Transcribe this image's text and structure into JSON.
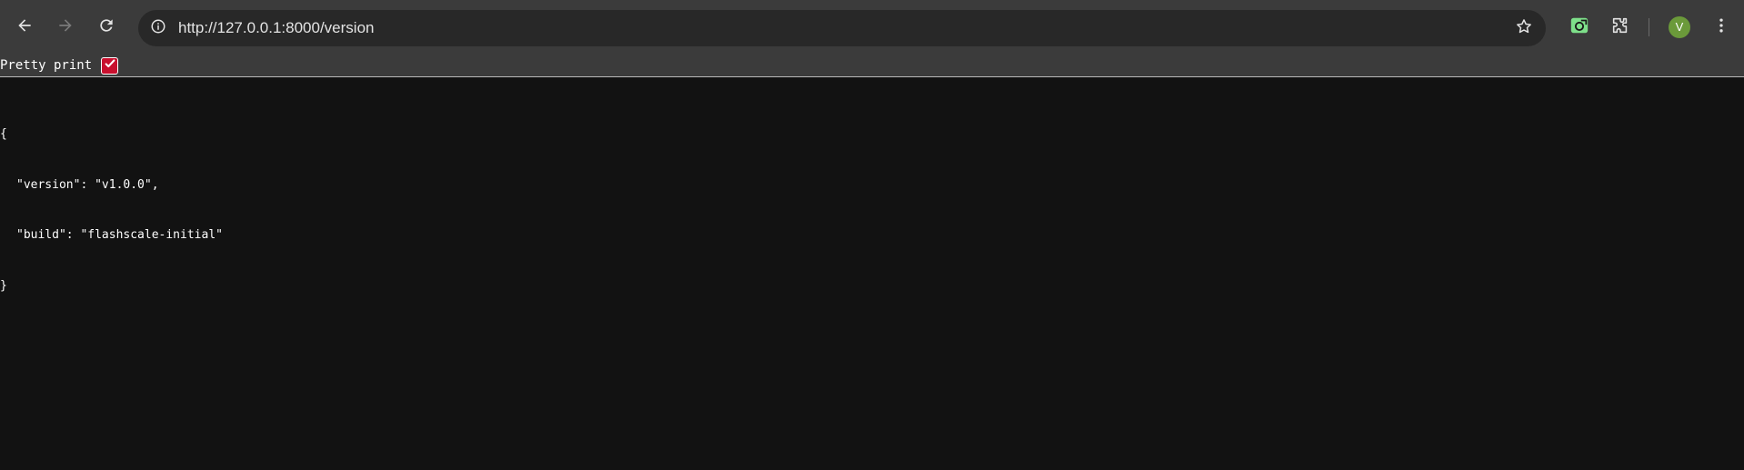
{
  "browser": {
    "url": "http://127.0.0.1:8000/version",
    "profile_initial": "V",
    "avatar_color": "#6b9a3a"
  },
  "icons": {
    "back": "back-arrow-icon",
    "forward": "forward-arrow-icon",
    "reload": "reload-icon",
    "site_info": "info-icon",
    "bookmark": "star-icon",
    "extension_1": "screen-capture-extension-icon",
    "extensions": "puzzle-icon",
    "menu": "kebab-menu-icon"
  },
  "pretty_print": {
    "label": "Pretty print",
    "checked": true,
    "checkbox_color": "#c8102e"
  },
  "json": {
    "open_brace": "{",
    "line1": "\"version\": \"v1.0.0\",",
    "line2": "\"build\": \"flashscale-initial\"",
    "close_brace": "}"
  }
}
